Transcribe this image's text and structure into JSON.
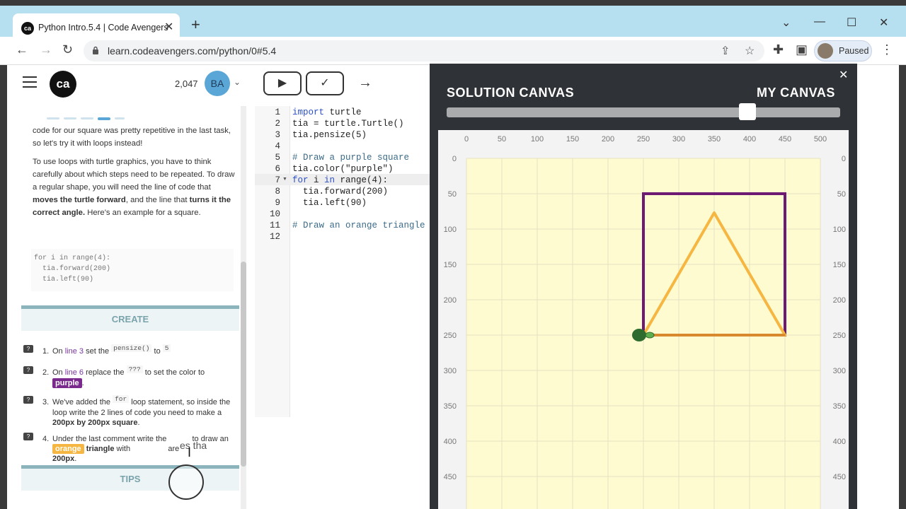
{
  "browser": {
    "tab_title": "Python Intro.5.4 | Code Avengers",
    "url": "learn.codeavengers.com/python/0#5.4",
    "profile_label": "Paused"
  },
  "header": {
    "points": "2,047",
    "avatar_initials": "BA",
    "logo_text": "ca"
  },
  "lesson": {
    "intro_partial": "code for our square was pretty repetitive in the last task, so let's try it with loops instead!",
    "para_prefix": "To use loops with turtle graphics, you have to think carefully about which steps need to be repeated. To draw a regular shape, you will need the line of code that ",
    "para_bold1": "moves the turtle forward",
    "para_mid": ", and the line that ",
    "para_bold2": "turns it the correct angle.",
    "para_suffix": " Here's an example for a square.",
    "example_code": [
      "for i in range(4):",
      "  tia.forward(200)",
      "  tia.left(90)"
    ],
    "create_heading": "CREATE",
    "tips_heading": "TIPS",
    "tasks": [
      {
        "num": "1.",
        "a": "On ",
        "b": "line 3",
        "c": " set the ",
        "d": "pensize()",
        "e": " to ",
        "f": "5"
      },
      {
        "num": "2.",
        "a": "On ",
        "b": "line 6",
        "c": " replace the ",
        "d": "???",
        "e": " to set the color to ",
        "f": "purple"
      },
      {
        "num": "3.",
        "a": "We've added the ",
        "b": "for",
        "c": " loop statement, so inside the loop write the 2 lines of code you need to make a ",
        "d": "200px by 200px square",
        "e": "."
      },
      {
        "num": "4.",
        "a": "Under the last comment write the ",
        "b": "to draw an ",
        "c": "orange",
        "d": "triangle",
        "e": " with ",
        "f": "are",
        "g": "200px",
        "h": "."
      }
    ],
    "cursor_ghost_text": "es tha"
  },
  "editor": {
    "line_numbers": [
      "1",
      "2",
      "3",
      "4",
      "5",
      "6",
      "7",
      "8",
      "9",
      "10",
      "11",
      "12"
    ],
    "lines": [
      "import turtle",
      "tia = turtle.Turtle()",
      "tia.pensize(5)",
      "",
      "# Draw a purple square",
      "tia.color(\"purple\")",
      "for i in range(4):",
      "  tia.forward(200)",
      "  tia.left(90)",
      "",
      "# Draw an orange triangle",
      ""
    ]
  },
  "canvas": {
    "solution_label": "SOLUTION CANVAS",
    "my_label": "MY CANVAS",
    "slider_value": 0.75,
    "x_ticks": [
      0,
      50,
      100,
      150,
      200,
      250,
      300,
      350,
      400,
      450,
      500
    ],
    "y_ticks": [
      0,
      50,
      100,
      150,
      200,
      250,
      300,
      350,
      400,
      450
    ],
    "square": {
      "x0": 250,
      "y0": 50,
      "x1": 450,
      "y1": 250,
      "color": "#6e1a74"
    },
    "triangle": {
      "points": [
        [
          250,
          250
        ],
        [
          450,
          250
        ],
        [
          350,
          77
        ]
      ],
      "color": "#f5b642"
    },
    "turtle": {
      "x": 250,
      "y": 250,
      "color": "#2e6b2e"
    },
    "background": "#fffbd0"
  }
}
